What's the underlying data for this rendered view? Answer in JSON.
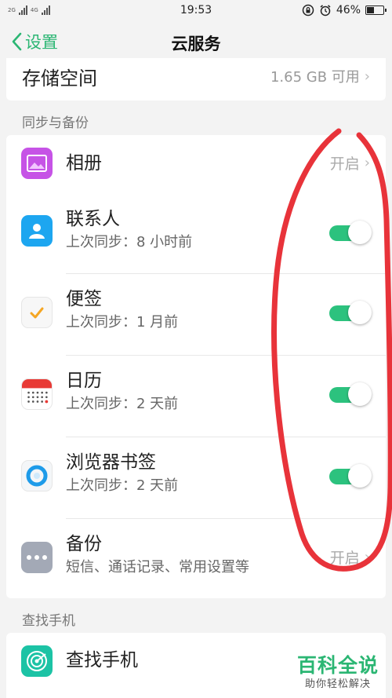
{
  "status_bar": {
    "net_1": "2G",
    "net_2": "4G",
    "time": "19:53",
    "battery": "46%",
    "battery_level": 0.46
  },
  "nav": {
    "back_label": "设置",
    "title": "云服务"
  },
  "storage": {
    "label": "存储空间",
    "value": "1.65 GB 可用"
  },
  "sync_section": {
    "header": "同步与备份",
    "items": [
      {
        "title": "相册",
        "status": "开启"
      },
      {
        "title": "联系人",
        "subtitle": "上次同步：8 小时前",
        "enabled": true
      },
      {
        "title": "便签",
        "subtitle": "上次同步：1 月前",
        "enabled": true
      },
      {
        "title": "日历",
        "subtitle": "上次同步：2 天前",
        "enabled": true
      },
      {
        "title": "浏览器书签",
        "subtitle": "上次同步：2 天前",
        "enabled": true
      },
      {
        "title": "备份",
        "subtitle": "短信、通话记录、常用设置等",
        "status": "开启"
      }
    ]
  },
  "find_section": {
    "header": "查找手机",
    "item_title": "查找手机"
  },
  "watermark": {
    "main": "百科全说",
    "sub": "助你轻松解决"
  },
  "colors": {
    "accent": "#2bb673",
    "toggle_on": "#2cc27e",
    "annotation": "#e8333a"
  }
}
